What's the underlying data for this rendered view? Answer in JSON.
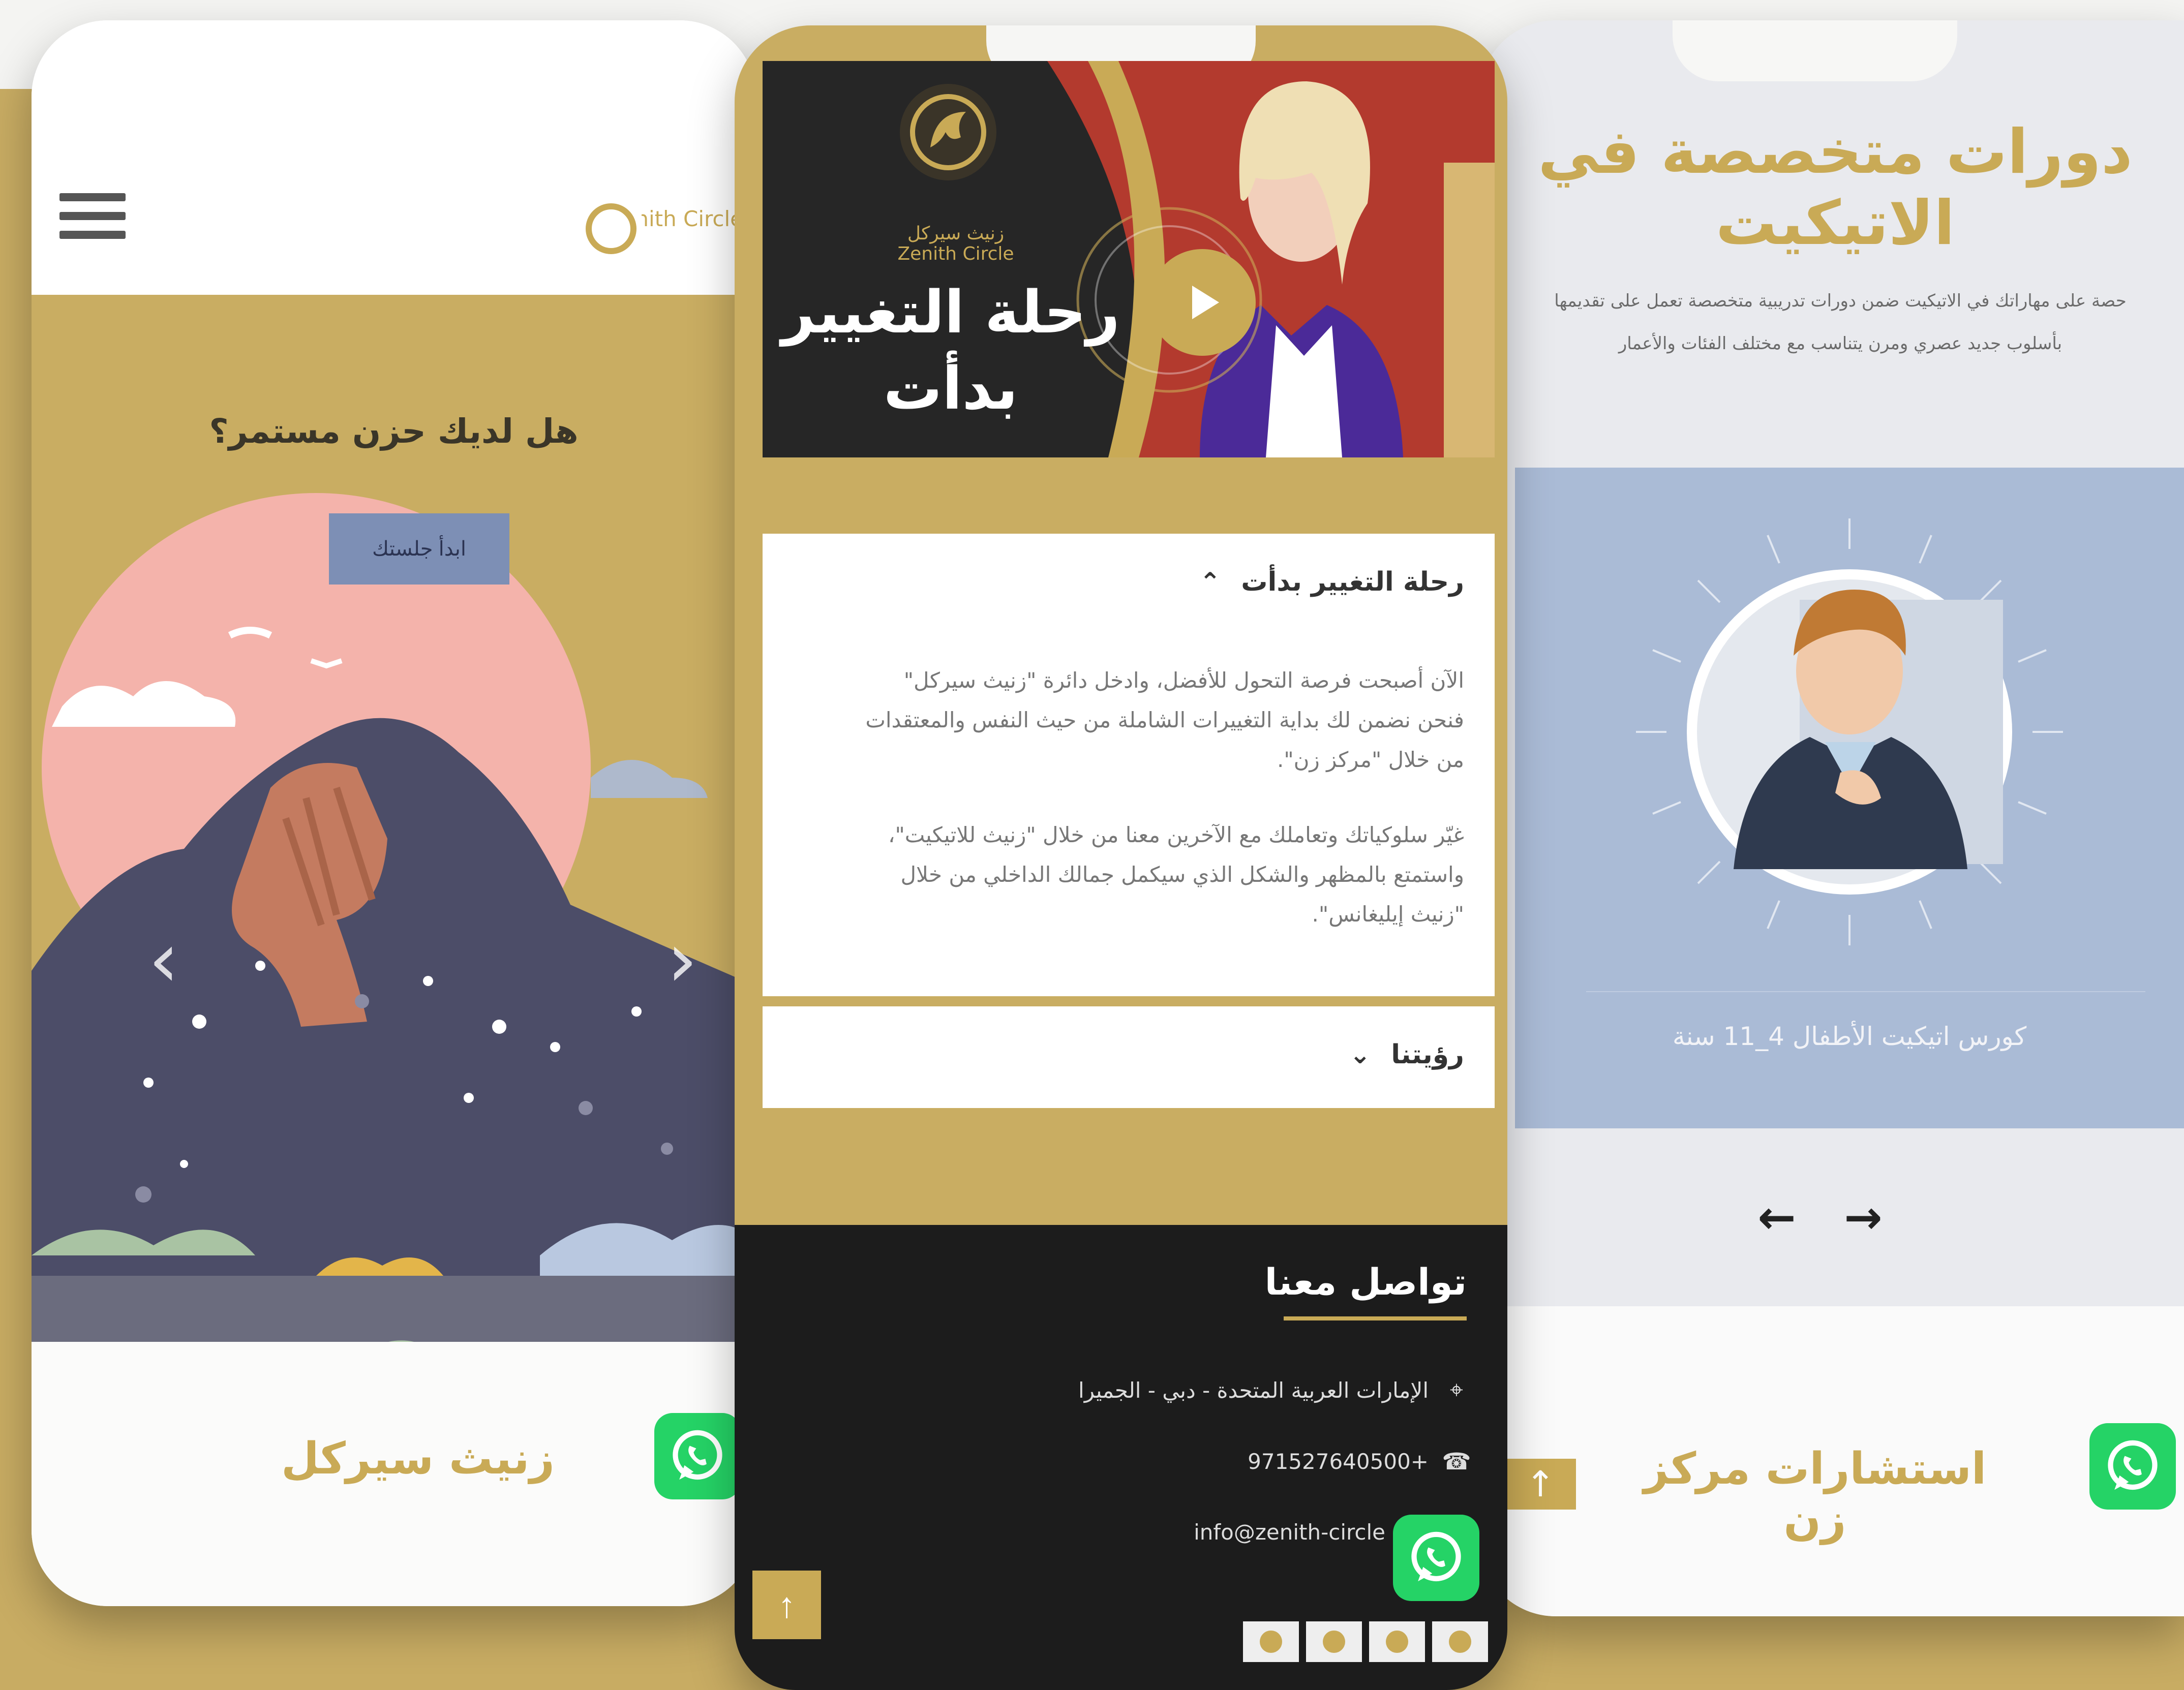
{
  "left_phone": {
    "logo_text": "Zenith Circle",
    "question": "هل لديك حزن مستمر؟",
    "cta_label": "ابدأ جلستك",
    "brand_label": "زنيث سيركل"
  },
  "middle_phone": {
    "video": {
      "brand": "زنيث سيركل Zenith Circle",
      "title": "رحلة التغيير بدأت"
    },
    "accordion": [
      {
        "title": "رحلة التغيير بدأت",
        "expanded": true,
        "paragraphs": [
          "الآن أصبحت فرصة التحول للأفضل، وادخل دائرة \"زنيث سيركل\" فنحن نضمن لك بداية التغييرات الشاملة من حيث النفس والمعتقدات من خلال \"مركز زن\".",
          "غيّر سلوكياتك وتعاملك مع الآخرين معنا من خلال \"زنيث للاتيكيت\"، واستمتع بالمظهر والشكل الذي سيكمل جمالك الداخلي من خلال \"زنيث إيليغانس\"."
        ]
      },
      {
        "title": "رؤيتنا",
        "expanded": false
      }
    ],
    "footer": {
      "title": "تواصل معنا",
      "address": "الإمارات العربية المتحدة - دبي - الجميرا",
      "phone": "+971527640500",
      "email": "info@zenith-circle"
    }
  },
  "right_phone": {
    "title": "دورات متخصصة في الاتيكيت",
    "description": [
      "حصة على مهاراتك في الاتيكيت ضمن دورات تدريبية متخصصة تعمل على تقديمها",
      "بأسلوب جديد عصري ومرن يتناسب مع مختلف الفئات والأعمار"
    ],
    "course_name": "كورس اتيكيت الأطفال 4_11 سنة",
    "brand_label": "استشارات مركز زن"
  },
  "colors": {
    "gold": "#c9aa56",
    "whatsapp": "#25d366",
    "footer_bg": "#1c1c1c",
    "card_blue": "#aabbd6"
  },
  "icons": [
    "menu-icon",
    "play-icon",
    "chevron-up-icon",
    "chevron-down-icon",
    "location-icon",
    "phone-icon",
    "whatsapp-icon",
    "arrow-up-icon",
    "arrow-left-icon",
    "arrow-right-icon"
  ]
}
